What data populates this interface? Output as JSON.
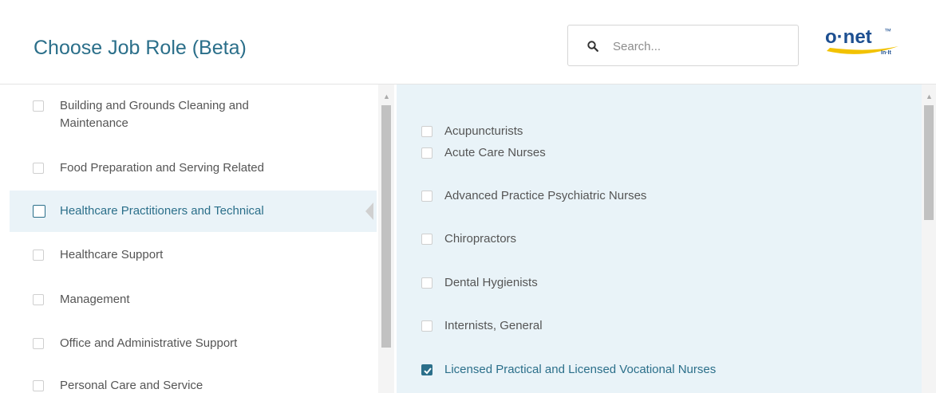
{
  "header": {
    "title": "Choose Job Role (Beta)",
    "search_placeholder": "Search...",
    "logo_text": "o·net",
    "logo_tm": "™",
    "logo_tagline": "In·It"
  },
  "categories": [
    {
      "label": "Building and Grounds Cleaning and Maintenance",
      "checked": false,
      "active": false
    },
    {
      "label": "Food Preparation and Serving Related",
      "checked": false,
      "active": false
    },
    {
      "label": "Healthcare Practitioners and Technical",
      "checked": false,
      "active": true
    },
    {
      "label": "Healthcare Support",
      "checked": false,
      "active": false
    },
    {
      "label": "Management",
      "checked": false,
      "active": false
    },
    {
      "label": "Office and Administrative Support",
      "checked": false,
      "active": false
    },
    {
      "label": "Personal Care and Service",
      "checked": false,
      "active": false
    }
  ],
  "roles": [
    {
      "label": "Acupuncturists",
      "checked": false
    },
    {
      "label": "Acute Care Nurses",
      "checked": false
    },
    {
      "label": "Advanced Practice Psychiatric Nurses",
      "checked": false
    },
    {
      "label": "Chiropractors",
      "checked": false
    },
    {
      "label": "Dental Hygienists",
      "checked": false
    },
    {
      "label": "Internists, General",
      "checked": false
    },
    {
      "label": "Licensed Practical and Licensed Vocational Nurses",
      "checked": true
    }
  ],
  "colors": {
    "accent": "#2b6f8a",
    "right_pane_bg": "#e9f3f8",
    "logo_blue": "#1d4f91",
    "logo_swoosh": "#f2c200"
  }
}
